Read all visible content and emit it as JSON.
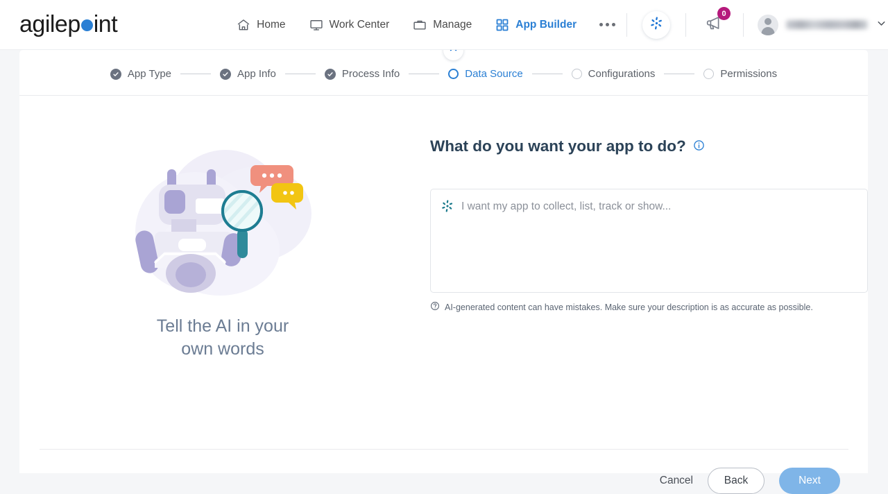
{
  "header": {
    "logo_text_a": "agilep",
    "logo_text_b": "int",
    "logo_dot_color": "#2a7fd4",
    "nav": [
      {
        "label": "Home",
        "icon": "home-icon",
        "active": false
      },
      {
        "label": "Work Center",
        "icon": "monitor-icon",
        "active": false
      },
      {
        "label": "Manage",
        "icon": "briefcase-icon",
        "active": false
      },
      {
        "label": "App Builder",
        "icon": "grid-icon",
        "active": true
      }
    ],
    "more_label": "",
    "ai_assistant_icon": "agilepoint-ai-pinwheel-icon",
    "notifications": {
      "icon": "megaphone-icon",
      "count": "0",
      "badge_color": "#b5197c"
    },
    "user": {
      "name": "",
      "chevron": "chevron-down-icon"
    }
  },
  "stepper": {
    "collapse_icon": "chevron-up-icon",
    "steps": [
      {
        "label": "App Type",
        "state": "done"
      },
      {
        "label": "App Info",
        "state": "done"
      },
      {
        "label": "Process Info",
        "state": "done"
      },
      {
        "label": "Data Source",
        "state": "current"
      },
      {
        "label": "Configurations",
        "state": "todo"
      },
      {
        "label": "Permissions",
        "state": "todo"
      }
    ]
  },
  "left": {
    "illustration": "ai-robot-with-magnifier-and-chat-bubbles",
    "title_line1": "Tell the AI in your",
    "title_line2": "own words"
  },
  "right": {
    "question": "What do you want your app to do?",
    "info_icon": "info-circle-icon",
    "prompt_icon": "agilepoint-ai-pinwheel-icon",
    "placeholder": "I want my app to collect, list, track or show...",
    "value": "",
    "helper_icon": "question-circle-icon",
    "helper_text": "AI-generated content can have mistakes. Make sure your description is as accurate as possible."
  },
  "footer": {
    "cancel_label": "Cancel",
    "back_label": "Back",
    "next_label": "Next",
    "next_color": "#7fb5e8"
  }
}
